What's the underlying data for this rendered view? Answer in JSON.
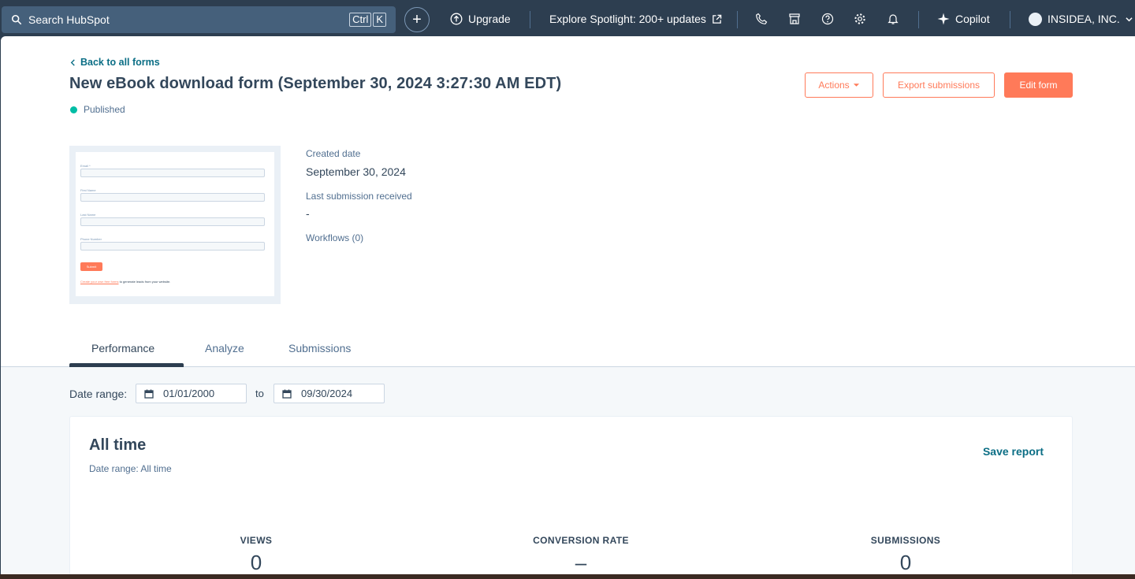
{
  "topnav": {
    "search_placeholder": "Search HubSpot",
    "shortcut_ctrl": "Ctrl",
    "shortcut_key": "K",
    "plus": "+",
    "upgrade": "Upgrade",
    "spotlight": "Explore Spotlight: 200+ updates",
    "copilot": "Copilot",
    "account": "INSIDEA, INC.",
    "icons": [
      "search-icon",
      "plus-icon",
      "upgrade-icon",
      "external-link-icon",
      "phone-icon",
      "marketplace-icon",
      "help-icon",
      "gear-icon",
      "bell-icon",
      "sparkle-icon",
      "avatar",
      "chevron-down-icon"
    ]
  },
  "header": {
    "back_link": "Back to all forms",
    "title": "New eBook download form (September 30, 2024 3:27:30 AM EDT)",
    "status": "Published",
    "actions": "Actions",
    "export": "Export submissions",
    "edit": "Edit form"
  },
  "preview": {
    "fields": [
      "Email *",
      "First Name",
      "Last Name",
      "Phone Number"
    ],
    "submit": "Submit",
    "footer_link": "Create your own free forms",
    "footer_text": " to generate leads from your website."
  },
  "details": {
    "created_label": "Created date",
    "created_value": "September 30, 2024",
    "last_sub_label": "Last submission received",
    "last_sub_value": "-",
    "workflows": "Workflows (0)"
  },
  "tabs": [
    {
      "label": "Performance",
      "active": true
    },
    {
      "label": "Analyze",
      "active": false
    },
    {
      "label": "Submissions",
      "active": false
    }
  ],
  "date_range": {
    "label": "Date range:",
    "from": "01/01/2000",
    "to_label": "to",
    "to": "09/30/2024"
  },
  "report": {
    "title": "All time",
    "subtitle": "Date range: All time",
    "save": "Save report",
    "metrics": [
      {
        "label": "VIEWS",
        "value": "0"
      },
      {
        "label": "CONVERSION RATE",
        "value": "–"
      },
      {
        "label": "SUBMISSIONS",
        "value": "0"
      }
    ]
  },
  "colors": {
    "nav_bg": "#2d3e50",
    "accent": "#ff7a59",
    "link": "#0b6e85",
    "published": "#00bda5"
  }
}
